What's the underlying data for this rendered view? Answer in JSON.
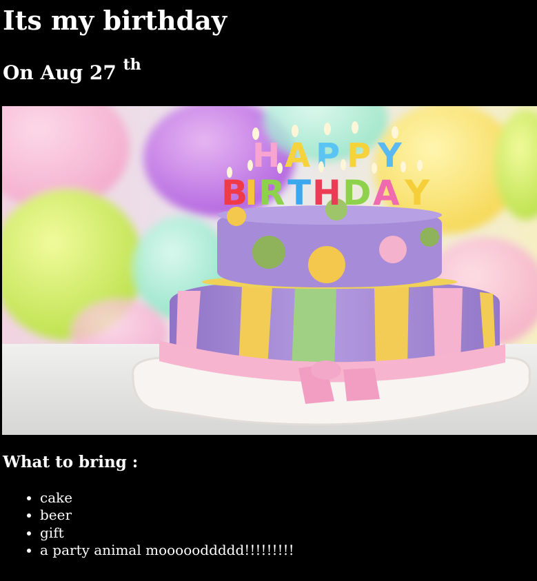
{
  "page": {
    "title": "Its my birthday",
    "date_prefix": "On Aug 27 ",
    "date_suffix": "th"
  },
  "image": {
    "cake_letters_top": "HAPPY",
    "cake_letters_bottom": "BIRTHDAY",
    "colors": {
      "background": "#000000",
      "text": "#ffffff",
      "cake_purple": "#a98fd6",
      "ribbon_pink": "#f6b3cf",
      "stripe_yellow": "#f3cc55",
      "stripe_green": "#9fd083"
    }
  },
  "bring": {
    "heading": "What to bring :",
    "items": [
      "cake",
      "beer",
      "gift",
      "a party animal moooooddddd!!!!!!!!!"
    ]
  }
}
